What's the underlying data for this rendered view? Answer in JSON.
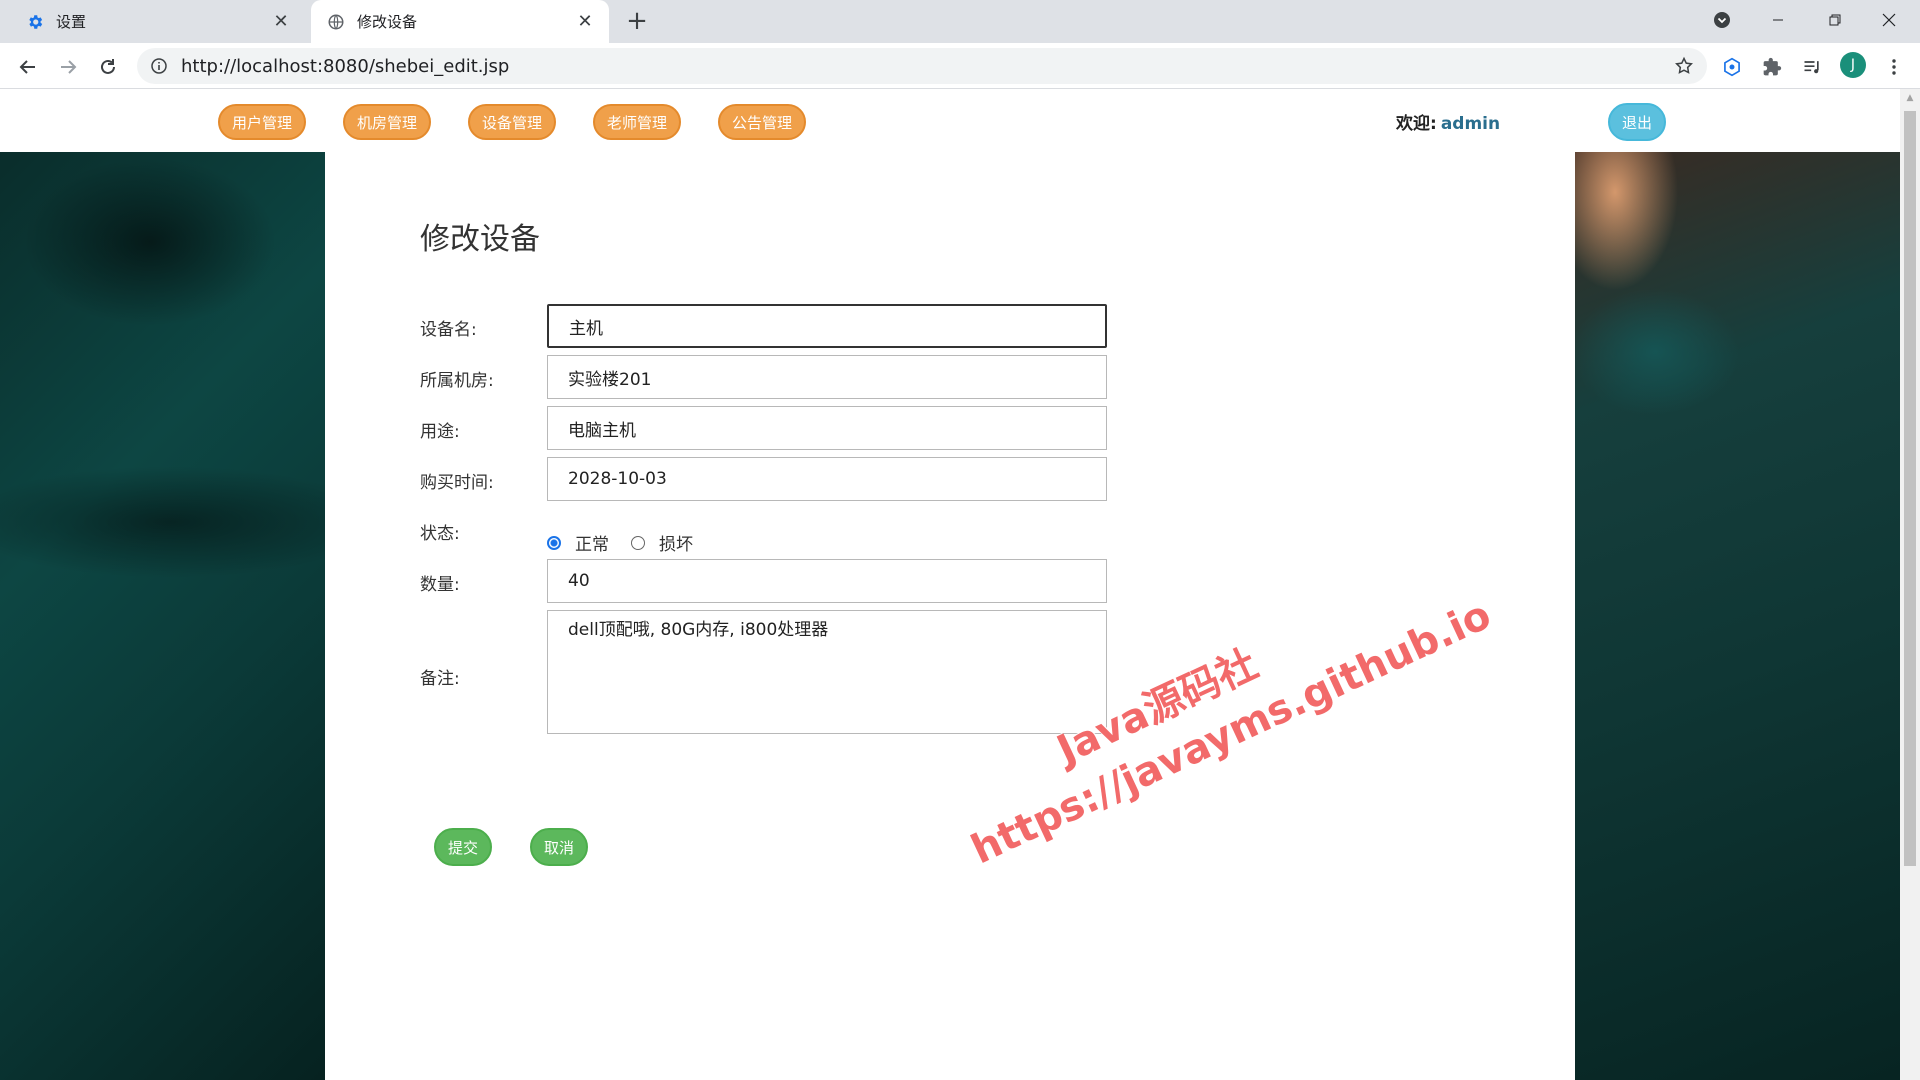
{
  "browser": {
    "tabs": [
      {
        "title": "设置",
        "icon": "gear-icon"
      },
      {
        "title": "修改设备",
        "icon": "globe-icon"
      }
    ],
    "url": "http://localhost:8080/shebei_edit.jsp",
    "profile_initial": "J",
    "close_glyph": "✕",
    "new_tab_glyph": "+"
  },
  "header": {
    "nav": [
      "用户管理",
      "机房管理",
      "设备管理",
      "老师管理",
      "公告管理"
    ],
    "welcome_label": "欢迎:",
    "username": "admin",
    "logout_label": "退出",
    "colors": {
      "nav_pill": "#f0a04a",
      "logout": "#5bc0de"
    }
  },
  "form": {
    "title": "修改设备",
    "fields": {
      "name": {
        "label": "设备名:",
        "value": "主机"
      },
      "room": {
        "label": "所属机房:",
        "value": "实验楼201"
      },
      "usage": {
        "label": "用途:",
        "value": "电脑主机"
      },
      "purchase_time": {
        "label": "购买时间:",
        "value": "2028-10-03"
      },
      "status": {
        "label": "状态:",
        "options": [
          "正常",
          "损坏"
        ],
        "selected": "正常"
      },
      "quantity": {
        "label": "数量:",
        "value": "40"
      },
      "remark": {
        "label": "备注:",
        "value": "dell顶配哦, 80G内存, i800处理器"
      }
    },
    "submit_label": "提交",
    "cancel_label": "取消",
    "button_color": "#5cb85c"
  },
  "watermark": {
    "line1": "Java源码社",
    "line2": "https://javayms.github.io"
  }
}
